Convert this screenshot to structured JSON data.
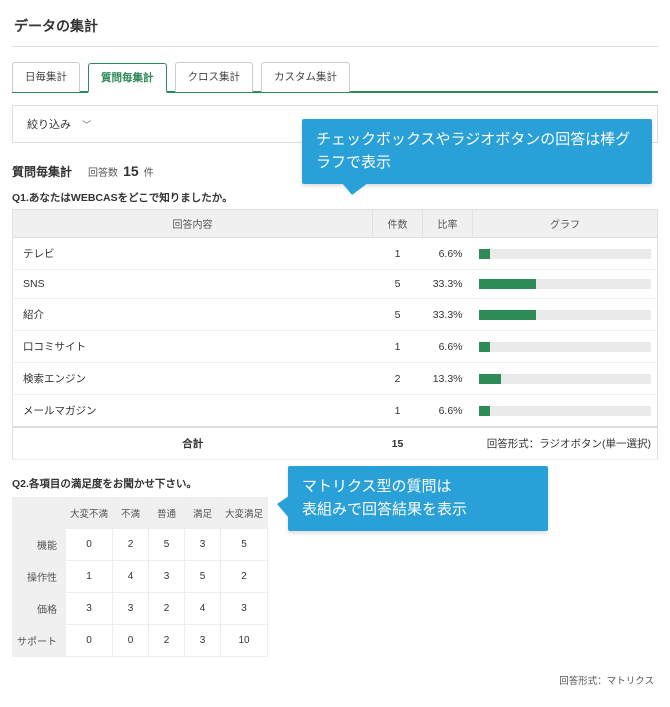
{
  "page_title": "データの集計",
  "tabs": [
    {
      "label": "日毎集計",
      "active": false
    },
    {
      "label": "質問毎集計",
      "active": true
    },
    {
      "label": "クロス集計",
      "active": false
    },
    {
      "label": "カスタム集計",
      "active": false
    }
  ],
  "filter": {
    "label": "絞り込み"
  },
  "section": {
    "heading": "質問毎集計",
    "count_label": "回答数",
    "count_value": "15",
    "count_unit": "件"
  },
  "q1": {
    "title": "Q1.あなたはWEBCASをどこで知りましたか。",
    "headers": {
      "content": "回答内容",
      "count": "件数",
      "rate": "比率",
      "graph": "グラフ"
    },
    "rows": [
      {
        "label": "テレビ",
        "count": 1,
        "rate": "6.6%",
        "pct": 6.6
      },
      {
        "label": "SNS",
        "count": 5,
        "rate": "33.3%",
        "pct": 33.3
      },
      {
        "label": "紹介",
        "count": 5,
        "rate": "33.3%",
        "pct": 33.3
      },
      {
        "label": "口コミサイト",
        "count": 1,
        "rate": "6.6%",
        "pct": 6.6
      },
      {
        "label": "検索エンジン",
        "count": 2,
        "rate": "13.3%",
        "pct": 13.3
      },
      {
        "label": "メールマガジン",
        "count": 1,
        "rate": "6.6%",
        "pct": 6.6
      }
    ],
    "total_label": "合計",
    "total_value": 15,
    "format_note": "回答形式：ラジオボタン(単一選択)"
  },
  "q2": {
    "title": "Q2.各項目の満足度をお聞かせ下さい。",
    "col_headers": [
      "大変不満",
      "不満",
      "普通",
      "満足",
      "大変満足"
    ],
    "rows": [
      {
        "label": "機能",
        "values": [
          0,
          2,
          5,
          3,
          5
        ]
      },
      {
        "label": "操作性",
        "values": [
          1,
          4,
          3,
          5,
          2
        ]
      },
      {
        "label": "価格",
        "values": [
          3,
          3,
          2,
          4,
          3
        ]
      },
      {
        "label": "サポート",
        "values": [
          0,
          0,
          2,
          3,
          10
        ]
      }
    ],
    "format_note": "回答形式：マトリクス"
  },
  "callouts": {
    "c1": "チェックボックスやラジオボタンの回答は棒グラフで表示",
    "c2": "マトリクス型の質問は\n表組みで回答結果を表示"
  },
  "chart_data": {
    "type": "bar",
    "orientation": "horizontal",
    "title": "Q1.あなたはWEBCASをどこで知りましたか。",
    "categories": [
      "テレビ",
      "SNS",
      "紹介",
      "口コミサイト",
      "検索エンジン",
      "メールマガジン"
    ],
    "values": [
      6.6,
      33.3,
      33.3,
      6.6,
      13.3,
      6.6
    ],
    "counts": [
      1,
      5,
      5,
      1,
      2,
      1
    ],
    "xlabel": "比率 (%)",
    "ylabel": "回答内容",
    "xlim": [
      0,
      100
    ]
  }
}
